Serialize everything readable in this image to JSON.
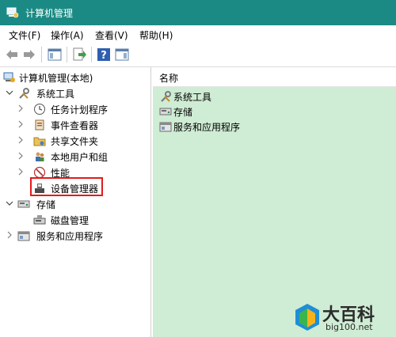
{
  "window": {
    "title": "计算机管理"
  },
  "menu": [
    "文件(F)",
    "操作(A)",
    "查看(V)",
    "帮助(H)"
  ],
  "toolbar": {
    "buttons": [
      "back-icon",
      "forward-icon",
      "show-hide-tree-icon",
      "export-list-icon",
      "help-icon",
      "show-action-pane-icon"
    ]
  },
  "tree": {
    "root": "计算机管理(本地)",
    "system_tools": {
      "label": "系统工具",
      "children": [
        "任务计划程序",
        "事件查看器",
        "共享文件夹",
        "本地用户和组",
        "性能",
        "设备管理器"
      ]
    },
    "storage": {
      "label": "存储",
      "children": [
        "磁盘管理"
      ]
    },
    "services": {
      "label": "服务和应用程序"
    }
  },
  "right": {
    "header": "名称",
    "items": [
      "系统工具",
      "存储",
      "服务和应用程序"
    ]
  },
  "watermark": {
    "title": "大百科",
    "site": "big100.net"
  },
  "colors": {
    "titlebar": "#1b8a84",
    "content_bg": "#cfecd4",
    "highlight": "#e21b1b"
  }
}
